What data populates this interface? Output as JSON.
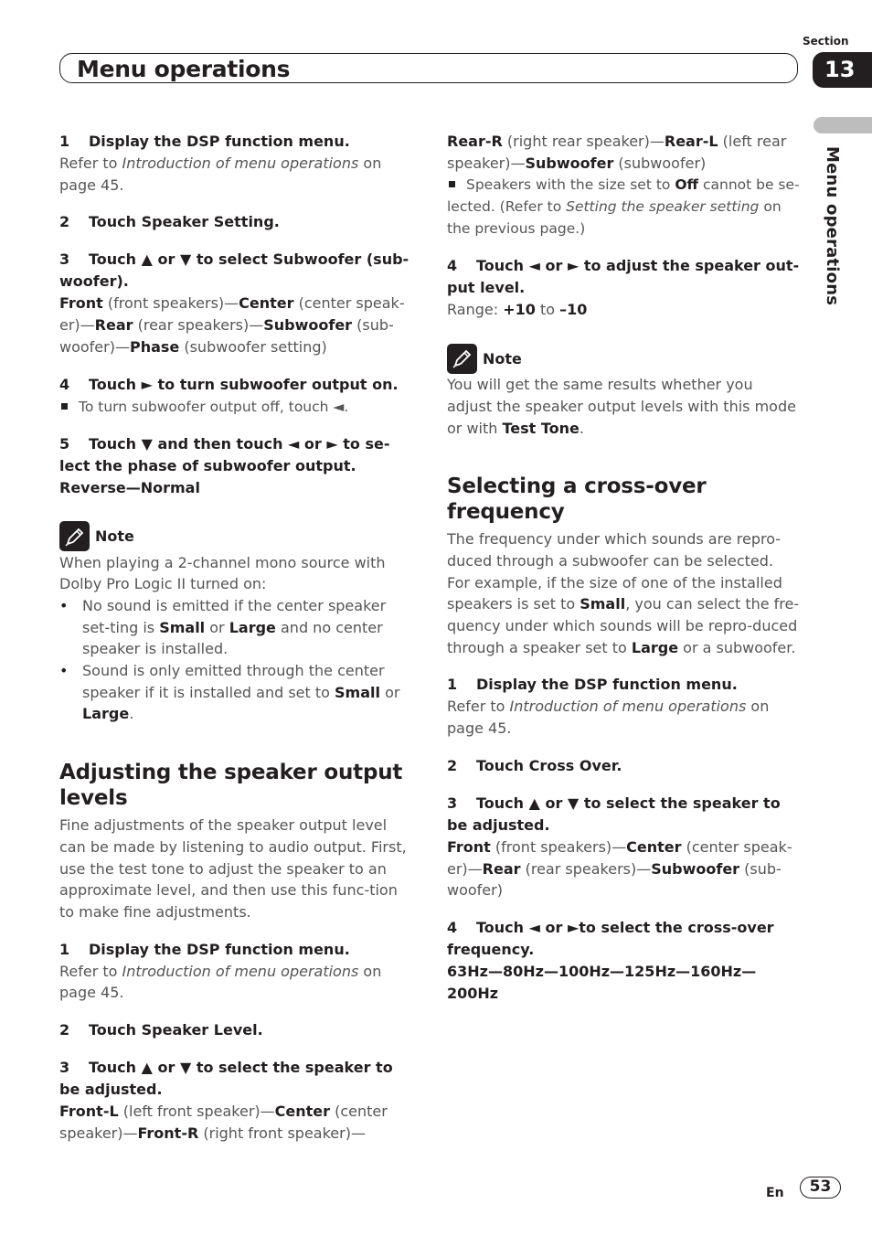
{
  "header": {
    "title": "Menu operations",
    "section_label": "Section",
    "section_number": "13",
    "side_tab": "Menu operations"
  },
  "left": {
    "s1_step": "Display the DSP function menu.",
    "s1_num": "1",
    "s1_body_pre": "Refer to ",
    "s1_body_ital": "Introduction of menu operations",
    "s1_body_post": " on page 45.",
    "s2_num": "2",
    "s2_step": "Touch Speaker Setting.",
    "s3_num": "3",
    "s3_step": "Touch ▲ or ▼ to select Subwoofer (sub-woofer).",
    "s3_options": [
      {
        "bold": "Front",
        "plain": " (front speakers)—"
      },
      {
        "bold": "Center",
        "plain": " (center speak-er)—"
      },
      {
        "bold": "Rear",
        "plain": " (rear speakers)—"
      },
      {
        "bold": "Subwoofer",
        "plain": " (sub-woofer)—"
      },
      {
        "bold": "Phase",
        "plain": " (subwoofer setting)"
      }
    ],
    "s4_num": "4",
    "s4_step": "Touch ► to turn subwoofer output on.",
    "s4_bullet": "To turn subwoofer output off, touch ◄.",
    "s5_num": "5",
    "s5_step": "Touch ▼ and then touch ◄ or ► to se-lect the phase of subwoofer output.",
    "s5_values": "Reverse—Normal",
    "note_label": "Note",
    "note_intro": "When playing a 2-channel mono source with Dolby Pro Logic II turned on:",
    "note_b1_a": "No sound is emitted if the center speaker set-ting is ",
    "note_b1_b1": "Small",
    "note_b1_c": " or ",
    "note_b1_b2": "Large",
    "note_b1_d": " and no center speaker is installed.",
    "note_b2_a": "Sound is only emitted through the center speaker if it is installed and set to ",
    "note_b2_b1": "Small",
    "note_b2_c": " or ",
    "note_b2_b2": "Large",
    "note_b2_d": ".",
    "h2": "Adjusting the speaker output levels",
    "h2_body": "Fine adjustments of the speaker output level can be made by listening to audio output. First, use the test tone to adjust the speaker to an approximate level, and then use this func-tion to make fine adjustments.",
    "t1_num": "1",
    "t1_step": "Display the DSP function menu.",
    "t1_body_pre": "Refer to ",
    "t1_body_ital": "Introduction of menu operations",
    "t1_body_post": " on page 45.",
    "t2_num": "2",
    "t2_step": "Touch Speaker Level.",
    "t3_num": "3",
    "t3_step": "Touch ▲ or ▼ to select the speaker to be adjusted.",
    "t3_options": [
      {
        "bold": "Front-L",
        "plain": " (left front speaker)—"
      },
      {
        "bold": "Center",
        "plain": " (center speaker)—"
      },
      {
        "bold": "Front-R",
        "plain": " (right front speaker)—"
      }
    ]
  },
  "right": {
    "t3_options_cont": [
      {
        "bold": "Rear-R",
        "plain": " (right rear speaker)—"
      },
      {
        "bold": "Rear-L",
        "plain": " (left rear speaker)—"
      },
      {
        "bold": "Subwoofer",
        "plain": " (subwoofer)"
      }
    ],
    "t3_bullet_a": "Speakers with the size set to ",
    "t3_bullet_b": "Off",
    "t3_bullet_c": " cannot be se-lected. (Refer to ",
    "t3_bullet_i": "Setting the speaker setting",
    "t3_bullet_d": " on the previous page.)",
    "t4_num": "4",
    "t4_step": "Touch ◄ or ► to adjust the speaker out-put level.",
    "t4_range_label": "Range: ",
    "t4_range_max": "+10",
    "t4_range_to": " to ",
    "t4_range_min": "–10",
    "note_label": "Note",
    "note_a": "You will get the same results whether you adjust the speaker output levels with this mode or with ",
    "note_b": "Test Tone",
    "note_c": ".",
    "h2": "Selecting a cross-over frequency",
    "h2_body_a": "The frequency under which sounds are repro-duced through a subwoofer can be selected. For example, if the size of one of the installed speakers is set to ",
    "h2_body_b": "Small",
    "h2_body_c": ", you can select the fre-quency under which sounds will be repro-duced through a speaker set to ",
    "h2_body_d": "Large",
    "h2_body_e": " or a subwoofer.",
    "c1_num": "1",
    "c1_step": "Display the DSP function menu.",
    "c1_body_pre": "Refer to ",
    "c1_body_ital": "Introduction of menu operations",
    "c1_body_post": " on page 45.",
    "c2_num": "2",
    "c2_step": "Touch Cross Over.",
    "c3_num": "3",
    "c3_step": "Touch ▲ or ▼ to select the speaker to be adjusted.",
    "c3_options": [
      {
        "bold": "Front",
        "plain": " (front speakers)—"
      },
      {
        "bold": "Center",
        "plain": " (center speak-er)—"
      },
      {
        "bold": "Rear",
        "plain": " (rear speakers)—"
      },
      {
        "bold": "Subwoofer",
        "plain": " (sub-woofer)"
      }
    ],
    "c4_num": "4",
    "c4_step": "Touch ◄ or ►to select the cross-over frequency.",
    "c4_values": "63Hz—80Hz—100Hz—125Hz—160Hz—200Hz"
  },
  "footer": {
    "lang": "En",
    "page": "53"
  }
}
